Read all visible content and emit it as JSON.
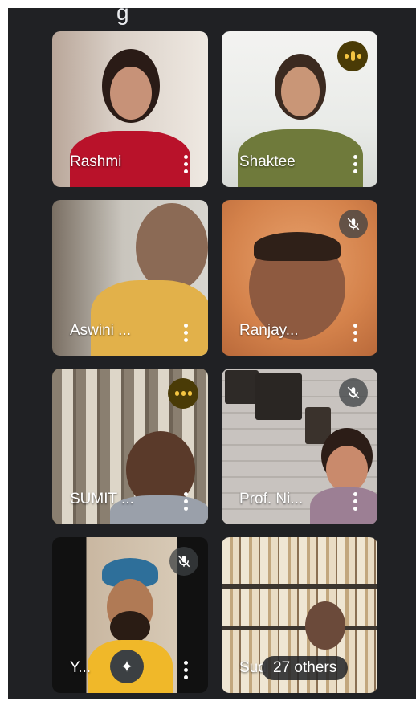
{
  "meeting": {
    "top_cut_text": "g",
    "participants": [
      {
        "name": "Rashmi",
        "status": "video",
        "mic": "on"
      },
      {
        "name": "Shaktee",
        "status": "speaking",
        "mic": "on"
      },
      {
        "name": "Aswini ...",
        "status": "video",
        "mic": "on"
      },
      {
        "name": "Ranjay...",
        "status": "video",
        "mic": "muted"
      },
      {
        "name": "SUMIT ...",
        "status": "speaking",
        "mic": "on"
      },
      {
        "name": "Prof. Ni...",
        "status": "video",
        "mic": "muted"
      },
      {
        "name": "Y...",
        "status": "video",
        "mic": "muted"
      },
      {
        "name": "Sud",
        "status": "video",
        "mic": "on"
      }
    ],
    "others_label": "27 others",
    "effects_icon": "sparkle-icon",
    "colors": {
      "background": "#202124",
      "speaking_indicator": "#f4c542",
      "active_border": "#5c4a12"
    }
  }
}
